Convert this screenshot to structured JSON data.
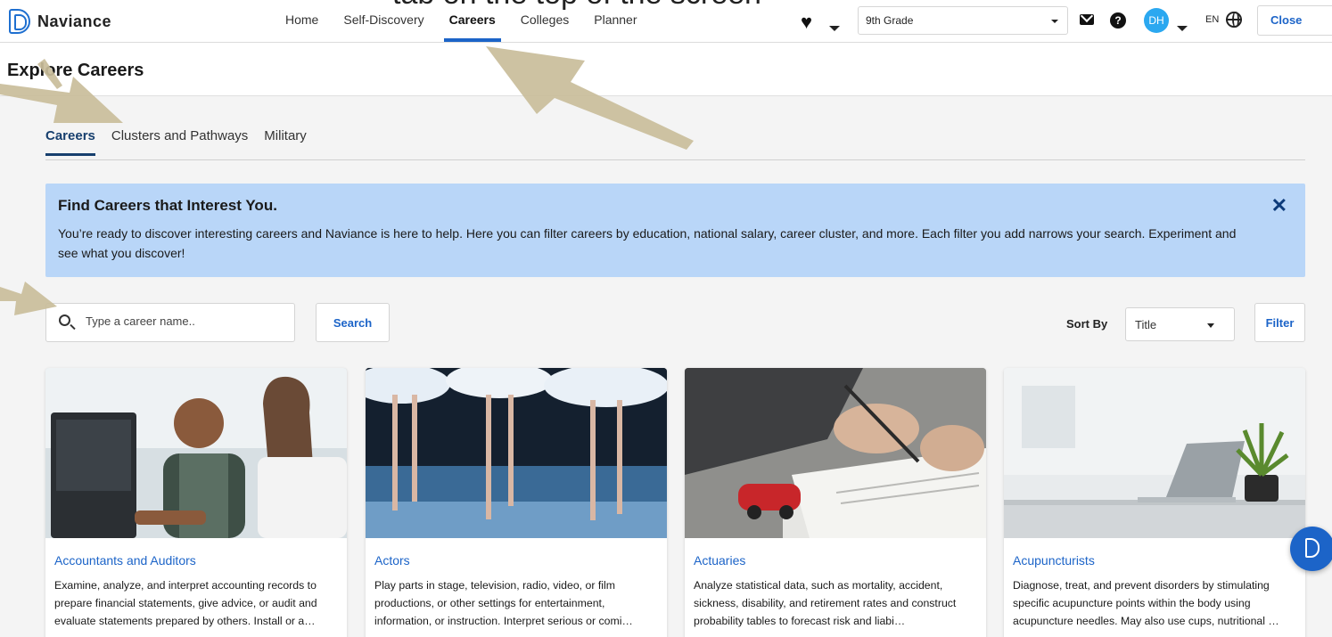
{
  "overlay_caption": "tab on the top of the screen",
  "app": {
    "name": "Naviance"
  },
  "nav": {
    "links": [
      "Home",
      "Self-Discovery",
      "Careers",
      "Colleges",
      "Planner"
    ],
    "active": "Careers"
  },
  "header": {
    "grade": "9th Grade",
    "avatar_initials": "DH",
    "language": "EN",
    "close_demo_label": "Close Demo"
  },
  "page": {
    "title": "Explore Careers"
  },
  "subtabs": {
    "items": [
      "Careers",
      "Clusters and Pathways",
      "Military"
    ],
    "active": "Careers"
  },
  "banner": {
    "title": "Find Careers that Interest You.",
    "text": "You’re ready to discover interesting careers and Naviance is here to help. Here you can filter careers by education, national salary, career cluster, and more. Each filter you add narrows your search. Experiment and see what you discover!"
  },
  "search": {
    "placeholder": "Type a career name..",
    "button_label": "Search"
  },
  "sort": {
    "label": "Sort By",
    "value": "Title"
  },
  "filter": {
    "label": "Filter"
  },
  "cards": [
    {
      "title": "Accountants and Auditors",
      "description": "Examine, analyze, and interpret accounting records to prepare financial statements, give advice, or audit and evaluate statements prepared by others. Install or a…"
    },
    {
      "title": "Actors",
      "description": "Play parts in stage, television, radio, video, or film productions, or other settings for entertainment, information, or instruction. Interpret serious or comi…"
    },
    {
      "title": "Actuaries",
      "description": "Analyze statistical data, such as mortality, accident, sickness, disability, and retirement rates and construct probability tables to forecast risk and liabi…"
    },
    {
      "title": "Acupuncturists",
      "description": "Diagnose, treat, and prevent disorders by stimulating specific acupuncture points within the body using acupuncture needles. May also use cups, nutritional …"
    }
  ],
  "colors": {
    "accent": "#1c64c8",
    "banner": "#b9d6f8",
    "active_tab": "#173f6e",
    "arrow": "#c9bd9a"
  }
}
